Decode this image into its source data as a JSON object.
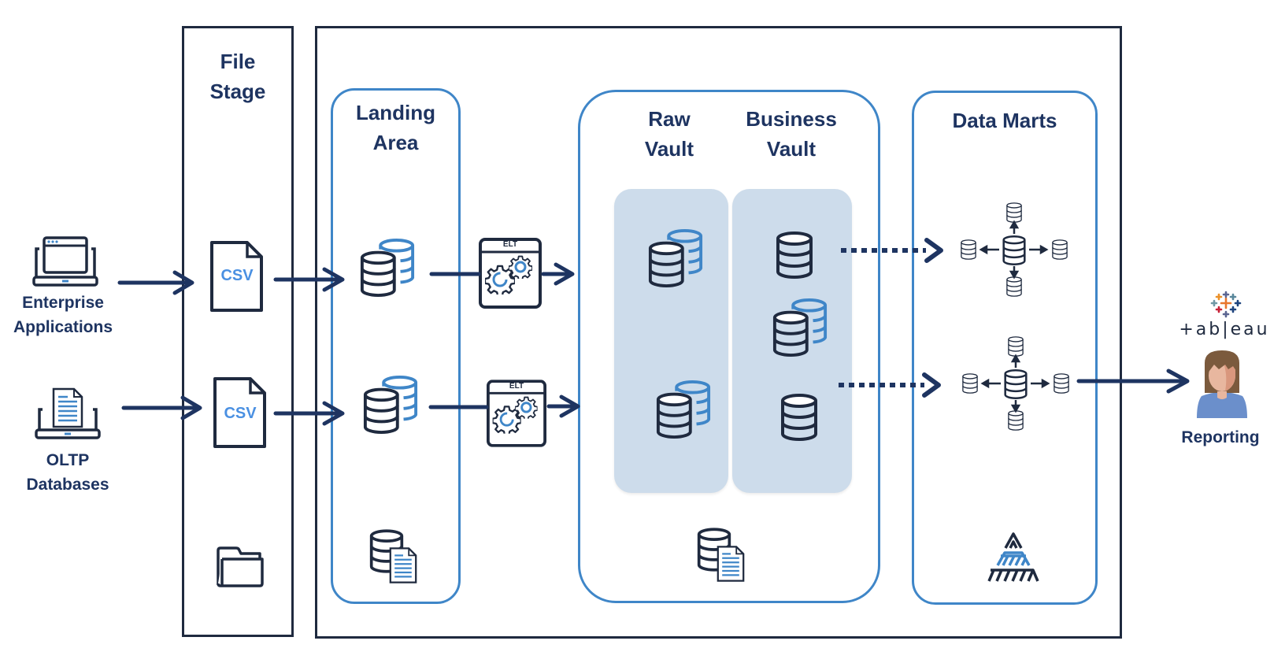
{
  "diagram": {
    "sources": [
      {
        "id": "enterprise",
        "icon": "laptop-window-icon",
        "label_line1": "Enterprise",
        "label_line2": "Applications"
      },
      {
        "id": "oltp",
        "icon": "laptop-document-icon",
        "label_line1": "OLTP",
        "label_line2": "Databases"
      }
    ],
    "file_stage": {
      "title_line1": "File",
      "title_line2": "Stage",
      "files": [
        {
          "icon": "csv-file-icon",
          "text": "CSV"
        },
        {
          "icon": "csv-file-icon",
          "text": "CSV"
        }
      ],
      "footer_icon": "folder-icon"
    },
    "landing_area": {
      "title_line1": "Landing",
      "title_line2": "Area",
      "footer_icon": "database-document-icon"
    },
    "elt": {
      "label": "ELT",
      "icon": "gears-icon"
    },
    "vault": {
      "raw_title_line1": "Raw",
      "raw_title_line2": "Vault",
      "business_title_line1": "Business",
      "business_title_line2": "Vault",
      "footer_icon": "database-document-icon"
    },
    "data_marts": {
      "title": "Data Marts",
      "star_schema_icon": "star-schema-icon",
      "footer_icon": "pyramid-icon"
    },
    "reporting": {
      "tool_name": "+ab|eau",
      "tool_icon": "tableau-logo-icon",
      "user_icon": "user-avatar-icon",
      "label": "Reporting"
    },
    "colors": {
      "navy": "#1e3461",
      "outline": "#1f2a3f",
      "accent_blue": "#3f86c8",
      "panel_fill": "#cddceb",
      "csv_text": "#4a90e2"
    },
    "connections": [
      {
        "from": "Enterprise Applications",
        "to": "CSV 1",
        "style": "solid"
      },
      {
        "from": "OLTP Databases",
        "to": "CSV 2",
        "style": "solid"
      },
      {
        "from": "CSV 1",
        "to": "Landing DB 1",
        "style": "solid"
      },
      {
        "from": "CSV 2",
        "to": "Landing DB 2",
        "style": "solid"
      },
      {
        "from": "Landing DB 1",
        "to": "ELT 1",
        "style": "solid"
      },
      {
        "from": "Landing DB 2",
        "to": "ELT 2",
        "style": "solid"
      },
      {
        "from": "ELT 1",
        "to": "Vault",
        "style": "solid"
      },
      {
        "from": "ELT 2",
        "to": "Vault",
        "style": "solid"
      },
      {
        "from": "Business Vault",
        "to": "Data Mart 1",
        "style": "dotted"
      },
      {
        "from": "Business Vault",
        "to": "Data Mart 2",
        "style": "dotted"
      },
      {
        "from": "Data Mart 2",
        "to": "Reporting",
        "style": "solid"
      }
    ]
  }
}
